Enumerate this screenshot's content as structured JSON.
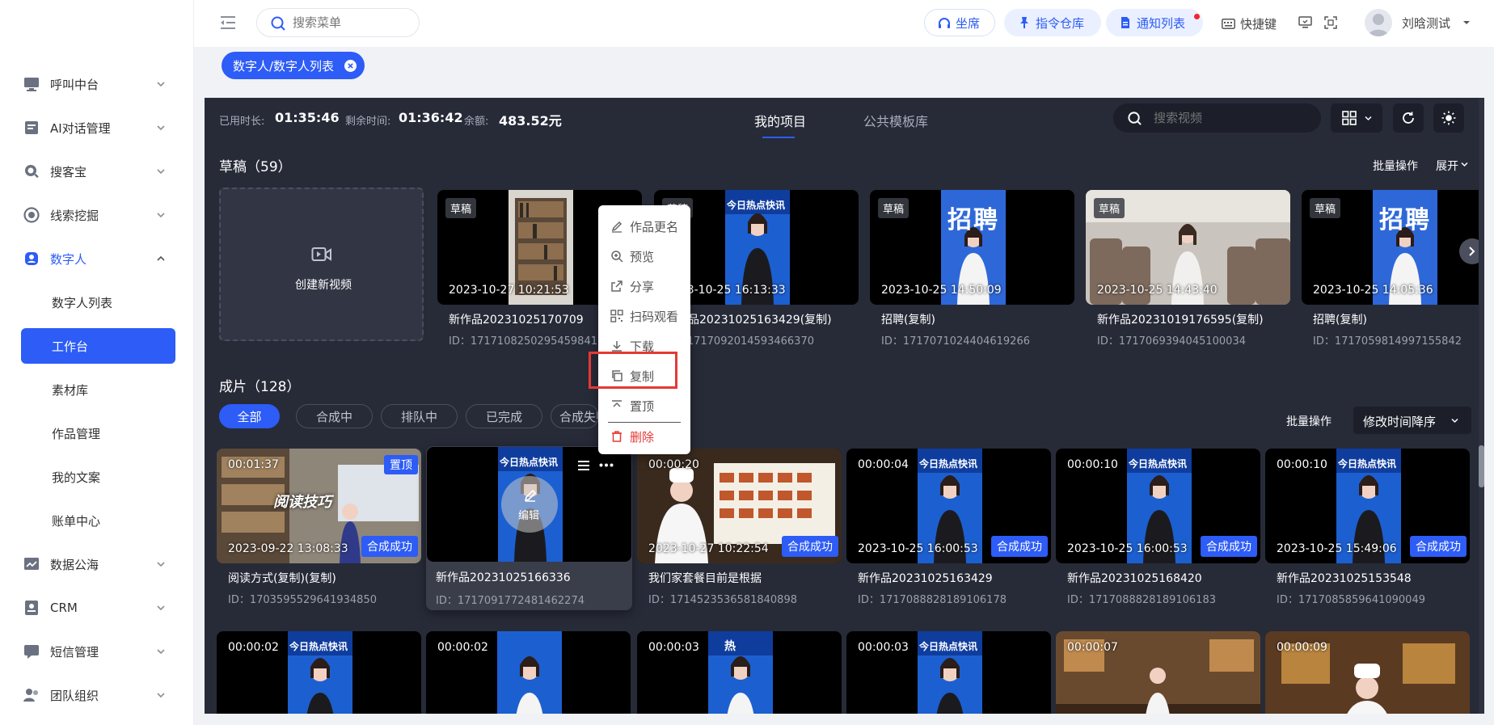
{
  "sidebar": {
    "items": [
      {
        "label": "呼叫中台",
        "icon": "monitor-icon"
      },
      {
        "label": "AI对话管理",
        "icon": "document-icon"
      },
      {
        "label": "搜客宝",
        "icon": "search-customer-icon"
      },
      {
        "label": "线索挖掘",
        "icon": "target-icon"
      },
      {
        "label": "数字人",
        "icon": "digital-human-icon"
      },
      {
        "label": "数据公海",
        "icon": "chart-icon"
      },
      {
        "label": "CRM",
        "icon": "contact-card-icon"
      },
      {
        "label": "短信管理",
        "icon": "message-icon"
      },
      {
        "label": "团队组织",
        "icon": "team-icon"
      }
    ],
    "sub_items": [
      "数字人列表",
      "工作台",
      "素材库",
      "作品管理",
      "我的文案",
      "账单中心"
    ]
  },
  "header": {
    "search_placeholder": "搜索菜单",
    "btn_agent": "坐席",
    "btn_commands": "指令仓库",
    "btn_notify": "通知列表",
    "btn_shortcut": "快捷键",
    "user_name": "刘晗测试"
  },
  "tags": {
    "current": "数字人/数字人列表"
  },
  "stats": {
    "used_label": "已用时长:",
    "used_value": "01:35:46",
    "remain_label": "剩余时间:",
    "remain_value": "01:36:42",
    "balance_label": "余额:",
    "balance_value": "483.52元"
  },
  "tabs": {
    "mine": "我的项目",
    "public": "公共模板库"
  },
  "video_search_placeholder": "搜索视频",
  "drafts": {
    "title": "草稿（59）",
    "batch": "批量操作",
    "expand": "展开",
    "create_label": "创建新视频",
    "tag": "草稿",
    "cards": [
      {
        "date": "2023-10-27 10:21:53",
        "title": "新作品20231025170709",
        "id": "ID：1717108250295459841"
      },
      {
        "date": "2023-10-25 16:13:33",
        "title": "新作品20231025163429(复制)",
        "id": "ID：1717092014593466370"
      },
      {
        "date": "2023-10-25 14:50:09",
        "title": "招聘(复制)",
        "id": "ID：1717071024404619266"
      },
      {
        "date": "2023-10-25 14:43:40",
        "title": "新作品20231019176595(复制)",
        "id": "ID：1717069394045100034"
      },
      {
        "date": "2023-10-25 14:05:36",
        "title": "招聘(复制)",
        "id": "ID：1717059814997155842"
      }
    ]
  },
  "finished": {
    "title": "成片（128）",
    "filters": [
      "全部",
      "合成中",
      "排队中",
      "已完成",
      "合成失败"
    ],
    "batch": "批量操作",
    "sort": "修改时间降序",
    "pin_badge": "置顶",
    "ok_badge": "合成成功",
    "edit_label": "编辑",
    "cards": [
      {
        "dur": "00:01:37",
        "date": "2023-09-22 13:08:33",
        "title": "阅读方式(复制)(复制)",
        "id": "ID：1703595529641934850"
      },
      {
        "dur": "",
        "date": "",
        "title": "新作品20231025166336",
        "id": "ID：1717091772481462274"
      },
      {
        "dur": "00:00:20",
        "date": "2023-10-27 10:22:54",
        "title": "我们家套餐目前是根据",
        "id": "ID：1714523536581840898"
      },
      {
        "dur": "00:00:04",
        "date": "2023-10-25 16:00:53",
        "title": "新作品20231025163429",
        "id": "ID：1717088828189106178"
      },
      {
        "dur": "00:00:10",
        "date": "2023-10-25 16:00:53",
        "title": "新作品20231025168420",
        "id": "ID：1717088828189106183"
      },
      {
        "dur": "00:00:10",
        "date": "2023-10-25 15:49:06",
        "title": "新作品20231025153548",
        "id": "ID：1717085859641090049"
      }
    ],
    "row2_durs": [
      "00:00:02",
      "00:00:02",
      "00:00:03",
      "00:00:03",
      "00:00:07",
      "00:00:09"
    ]
  },
  "context_menu": {
    "rename": "作品更名",
    "preview": "预览",
    "share": "分享",
    "qr": "扫码观看",
    "download": "下载",
    "copy": "复制",
    "pin": "置顶",
    "delete": "删除"
  },
  "thumb_texts": {
    "news": "今日热点快讯",
    "recruit": "招聘",
    "reading": "阅读技巧",
    "hot": "热"
  },
  "colors": {
    "accent": "#2d5cf6",
    "panel": "#272b38",
    "danger": "#e53935"
  }
}
